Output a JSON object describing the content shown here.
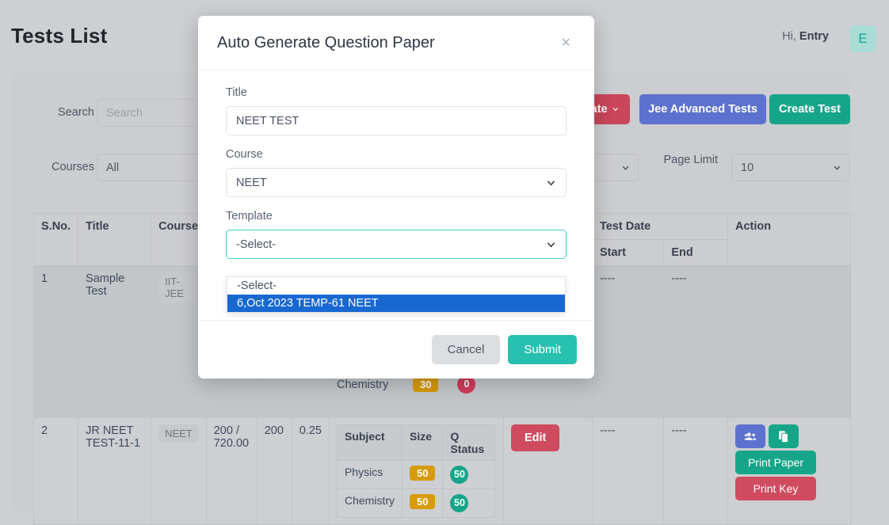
{
  "header": {
    "page_title": "Tests List",
    "greeting_prefix": "Hi,",
    "greeting_name": "Entry",
    "avatar_initial": "E"
  },
  "filters": {
    "search_label": "Search",
    "search_value": "",
    "search_placeholder": "Search",
    "courses_label": "Courses",
    "courses_value": "All",
    "page_limit_label": "Page Limit",
    "page_limit_value": "10"
  },
  "toolbar": {
    "generate_label": "rate",
    "jee_advanced_label": "Jee Advanced Tests",
    "create_test_label": "Create Test"
  },
  "table": {
    "headers": {
      "sno": "S.No.",
      "title": "Title",
      "course": "Course",
      "questions": "",
      "col4": "",
      "col5": "",
      "subjects": "",
      "action_col": "",
      "test_date": "Test Date",
      "start": "Start",
      "end": "End",
      "action": "Action"
    },
    "subject_headers": {
      "subject": "Subject",
      "size": "Size",
      "q_status": "Q Status"
    },
    "rows": [
      {
        "sno": "1",
        "title": "Sample Test",
        "course": "IIT-JEE",
        "marks": "",
        "count": "",
        "negative": "",
        "subjects": [
          {
            "name": "Chemistry",
            "size": "30",
            "q_status": "0",
            "q_ok": false
          }
        ],
        "edit_label": "",
        "start": "----",
        "end": "----"
      },
      {
        "sno": "2",
        "title": "JR NEET TEST-11-1",
        "course": "NEET",
        "marks": "200 / 720.00",
        "count": "200",
        "negative": "0.25",
        "subjects": [
          {
            "name": "Physics",
            "size": "50",
            "q_status": "50",
            "q_ok": true
          },
          {
            "name": "Chemistry",
            "size": "50",
            "q_status": "50",
            "q_ok": true
          }
        ],
        "edit_label": "Edit",
        "start": "----",
        "end": "----",
        "print_paper_label": "Print Paper",
        "print_key_label": "Print Key"
      }
    ]
  },
  "modal": {
    "title": "Auto Generate Question Paper",
    "close_label": "×",
    "title_field": {
      "label": "Title",
      "value": "NEET TEST"
    },
    "course_field": {
      "label": "Course",
      "value": "NEET"
    },
    "template_field": {
      "label": "Template",
      "value": "-Select-",
      "options": [
        {
          "label": "-Select-",
          "selected": false
        },
        {
          "label": "6,Oct 2023 TEMP-61 NEET",
          "selected": true
        }
      ]
    },
    "cancel_label": "Cancel",
    "submit_label": "Submit"
  },
  "colors": {
    "accent_teal": "#28c1b0",
    "focus_teal": "#3fd0c9",
    "option_blue": "#1868d1",
    "danger_red": "#cf4b60",
    "primary_blue": "#5c72ce",
    "size_orange": "#d79b09"
  }
}
